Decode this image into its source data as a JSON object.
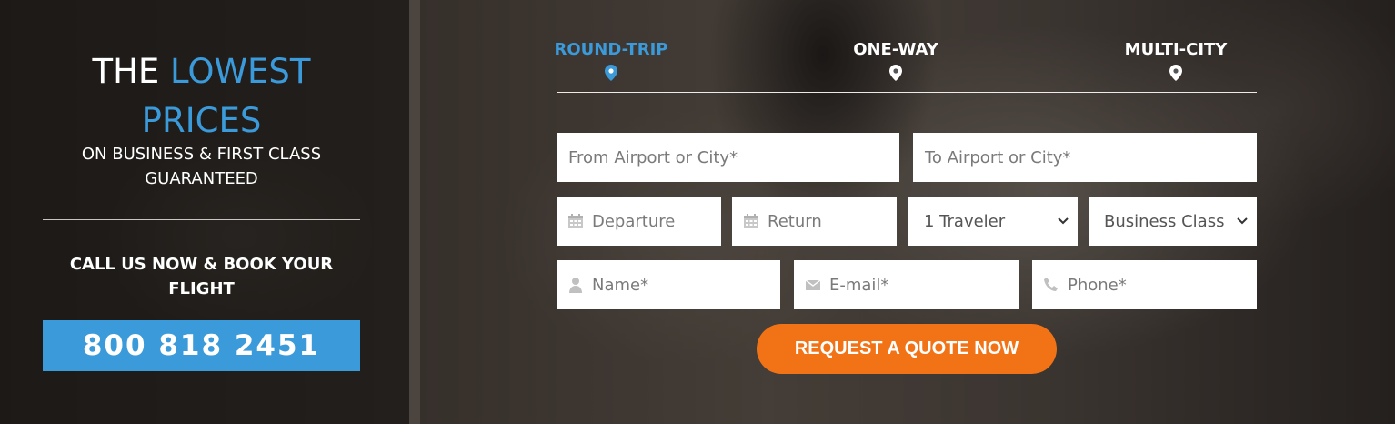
{
  "hero": {
    "headline_part1": "THE ",
    "headline_accent": "LOWEST PRICES",
    "subline": "ON BUSINESS & FIRST CLASS GUARANTEED",
    "callout": "CALL US NOW & BOOK YOUR FLIGHT",
    "phone": "800 818 2451"
  },
  "tabs": [
    {
      "label": "ROUND-TRIP",
      "active": true,
      "icon": "map-pin-icon"
    },
    {
      "label": "ONE-WAY",
      "active": false,
      "icon": "map-pin-icon"
    },
    {
      "label": "MULTI-CITY",
      "active": false,
      "icon": "map-pin-icon"
    }
  ],
  "form": {
    "from_placeholder": "From Airport or City*",
    "to_placeholder": "To Airport or City*",
    "departure_placeholder": "Departure",
    "return_placeholder": "Return",
    "travelers_selected": "1 Traveler",
    "class_selected": "Business Class",
    "name_placeholder": "Name*",
    "email_placeholder": "E-mail*",
    "phone_placeholder": "Phone*",
    "submit_label": "REQUEST A QUOTE NOW"
  },
  "colors": {
    "accent_blue": "#3b9ad9",
    "cta_orange": "#f27316",
    "text_white": "#ffffff",
    "placeholder_gray": "#7a7a7a"
  },
  "icons": {
    "departure": "calendar-icon",
    "return": "calendar-icon",
    "name": "user-icon",
    "email": "envelope-icon",
    "phone": "phone-icon",
    "select": "chevron-down-icon"
  }
}
